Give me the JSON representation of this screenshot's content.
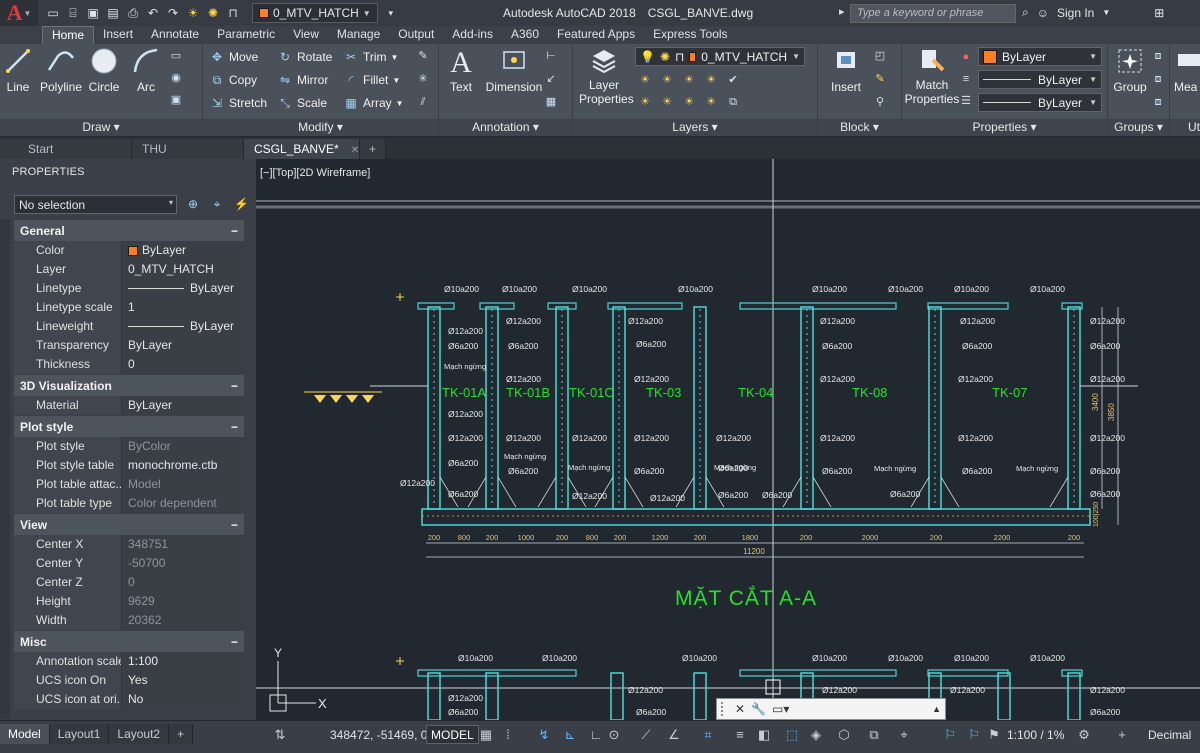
{
  "app": {
    "title": "Autodesk AutoCAD 2018",
    "file": "CSGL_BANVE.dwg",
    "logo": "A",
    "search_placeholder": "Type a keyword or phrase",
    "sign_in": "Sign In"
  },
  "qat": {
    "layer": "0_MTV_HATCH"
  },
  "ribbon_tabs": [
    "Home",
    "Insert",
    "Annotate",
    "Parametric",
    "View",
    "Manage",
    "Output",
    "Add-ins",
    "A360",
    "Featured Apps",
    "Express Tools"
  ],
  "ribbon": {
    "draw": {
      "title": "Draw",
      "buttons": [
        "Line",
        "Polyline",
        "Circle",
        "Arc"
      ]
    },
    "modify": {
      "title": "Modify",
      "items": [
        "Move",
        "Rotate",
        "Trim",
        "Copy",
        "Mirror",
        "Fillet",
        "Stretch",
        "Scale",
        "Array"
      ]
    },
    "annotation": {
      "title": "Annotation",
      "buttons": [
        "Text",
        "Dimension"
      ]
    },
    "layers": {
      "title": "Layers",
      "button": "Layer Properties",
      "current": "0_MTV_HATCH"
    },
    "block": {
      "title": "Block",
      "button": "Insert"
    },
    "properties": {
      "title": "Properties",
      "button": "Match Properties",
      "color": "ByLayer",
      "linetype": "ByLayer",
      "lineweight": "ByLayer"
    },
    "groups": {
      "title": "Groups",
      "button": "Group"
    },
    "utilities": {
      "title": "Ut",
      "button": "Mea"
    }
  },
  "file_tabs": [
    {
      "label": "Start"
    },
    {
      "label": "THU VIENCAD*"
    },
    {
      "label": "CSGL_BANVE*"
    }
  ],
  "properties_palette": {
    "title": "PROPERTIES",
    "selection": "No selection",
    "sections": [
      {
        "name": "General",
        "rows": [
          {
            "k": "Color",
            "v": "ByLayer"
          },
          {
            "k": "Layer",
            "v": "0_MTV_HATCH"
          },
          {
            "k": "Linetype",
            "v": "ByLayer"
          },
          {
            "k": "Linetype scale",
            "v": "1"
          },
          {
            "k": "Lineweight",
            "v": "ByLayer"
          },
          {
            "k": "Transparency",
            "v": "ByLayer"
          },
          {
            "k": "Thickness",
            "v": "0"
          }
        ]
      },
      {
        "name": "3D Visualization",
        "rows": [
          {
            "k": "Material",
            "v": "ByLayer"
          }
        ]
      },
      {
        "name": "Plot style",
        "rows": [
          {
            "k": "Plot style",
            "v": "ByColor"
          },
          {
            "k": "Plot style table",
            "v": "monochrome.ctb"
          },
          {
            "k": "Plot table attac...",
            "v": "Model"
          },
          {
            "k": "Plot table type",
            "v": "Color dependent"
          }
        ]
      },
      {
        "name": "View",
        "rows": [
          {
            "k": "Center X",
            "v": "348751"
          },
          {
            "k": "Center Y",
            "v": "-50700"
          },
          {
            "k": "Center Z",
            "v": "0"
          },
          {
            "k": "Height",
            "v": "9629"
          },
          {
            "k": "Width",
            "v": "20362"
          }
        ]
      },
      {
        "name": "Misc",
        "rows": [
          {
            "k": "Annotation scale",
            "v": "1:100"
          },
          {
            "k": "UCS icon On",
            "v": "Yes"
          },
          {
            "k": "UCS icon at ori...",
            "v": "No"
          }
        ]
      }
    ]
  },
  "viewport": {
    "label": "[−][Top][2D Wireframe]",
    "section_title": "MẶT CẮT A-A",
    "tank_labels": [
      "TK-01A",
      "TK-01B",
      "TK-01C",
      "TK-03",
      "TK-04",
      "TK-08",
      "TK-07"
    ],
    "rebar_notes": [
      "Ø10a200",
      "Ø12a200",
      "Ø6a200",
      "Mạch ngừng"
    ],
    "dims_bottom": [
      "200",
      "800",
      "200",
      "1000",
      "200",
      "800",
      "200",
      "1200",
      "200",
      "1800",
      "200",
      "2000",
      "200",
      "2200",
      "200"
    ],
    "dim_total": "11200",
    "dims_right": [
      "3400",
      "3850",
      "100|250"
    ],
    "ucs_y": "Y",
    "ucs_x": "X"
  },
  "statusbar": {
    "layout_tabs": [
      "Model",
      "Layout1",
      "Layout2"
    ],
    "coords": "348472, -51469, 0",
    "model": "MODEL",
    "scale": "1:100 / 1%",
    "units": "Decimal"
  },
  "colors": {
    "canvas": "#212830",
    "structure": "#4fd6d6",
    "labels": "#24e02b",
    "accent_layer": "#ff7f1e"
  }
}
